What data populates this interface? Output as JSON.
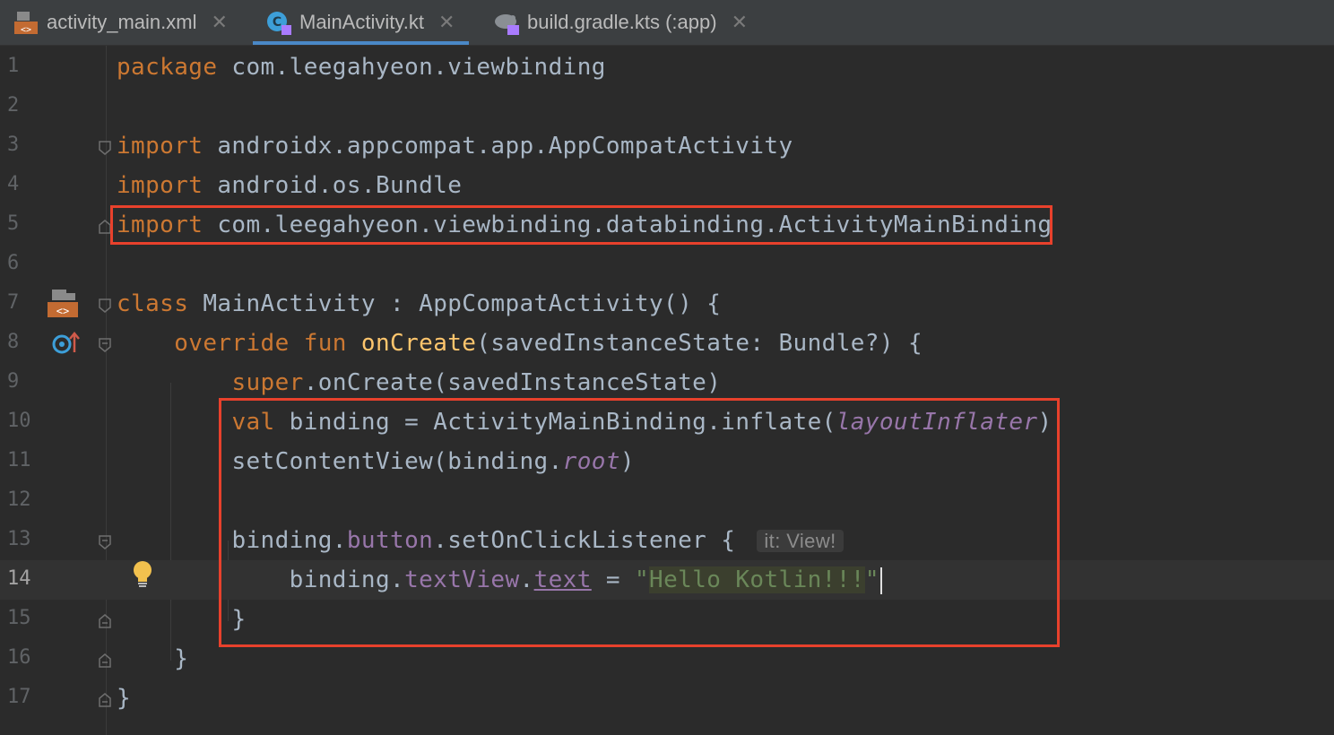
{
  "tabs": [
    {
      "label": "activity_main.xml",
      "icon": "xml-layout-icon",
      "active": false
    },
    {
      "label": "MainActivity.kt",
      "icon": "kotlin-class-icon",
      "active": true
    },
    {
      "label": "build.gradle.kts (:app)",
      "icon": "gradle-kotlin-icon",
      "active": false
    }
  ],
  "editor": {
    "current_line": 14,
    "lines": [
      {
        "n": "1"
      },
      {
        "n": "2"
      },
      {
        "n": "3"
      },
      {
        "n": "4"
      },
      {
        "n": "5"
      },
      {
        "n": "6"
      },
      {
        "n": "7"
      },
      {
        "n": "8"
      },
      {
        "n": "9"
      },
      {
        "n": "10"
      },
      {
        "n": "11"
      },
      {
        "n": "12"
      },
      {
        "n": "13"
      },
      {
        "n": "14"
      },
      {
        "n": "15"
      },
      {
        "n": "16"
      },
      {
        "n": "17"
      }
    ],
    "code": {
      "l1_kw": "package",
      "l1_rest": " com.leegahyeon.viewbinding",
      "l3_kw": "import",
      "l3_rest": " androidx.appcompat.app.AppCompatActivity",
      "l4_kw": "import",
      "l4_rest": " android.os.Bundle",
      "l5_kw": "import",
      "l5_rest": " com.leegahyeon.viewbinding.databinding.ActivityMainBinding",
      "l7_kw": "class",
      "l7_rest": " MainActivity : AppCompatActivity() {",
      "l8_kw": "override fun",
      "l8_fn": "onCreate",
      "l8_rest": "(savedInstanceState: Bundle?) {",
      "l9_kw": "super",
      "l9_rest": ".onCreate(savedInstanceState)",
      "l10_kw": "val",
      "l10_rest": " binding = ActivityMainBinding.inflate(",
      "l10_it": "layoutInflater",
      "l10_end": ")",
      "l11_a": "setContentView(binding.",
      "l11_it": "root",
      "l11_end": ")",
      "l13_a": "binding.",
      "l13_prop": "button",
      "l13_rest": ".setOnClickListener { ",
      "l13_hint": "it: View!",
      "l14_a": "binding.",
      "l14_prop": "textView",
      "l14_dot": ".",
      "l14_text": "text",
      "l14_eq": " = ",
      "l14_q1": "\"",
      "l14_str": "Hello Kotlin!!!",
      "l14_q2": "\"",
      "l15": "}",
      "l16": "}",
      "l17": "}"
    }
  },
  "colors": {
    "highlight_box": "#e8412c",
    "keyword": "#cc7832",
    "function": "#ffc66d",
    "property": "#9876aa",
    "string": "#6a8759"
  }
}
